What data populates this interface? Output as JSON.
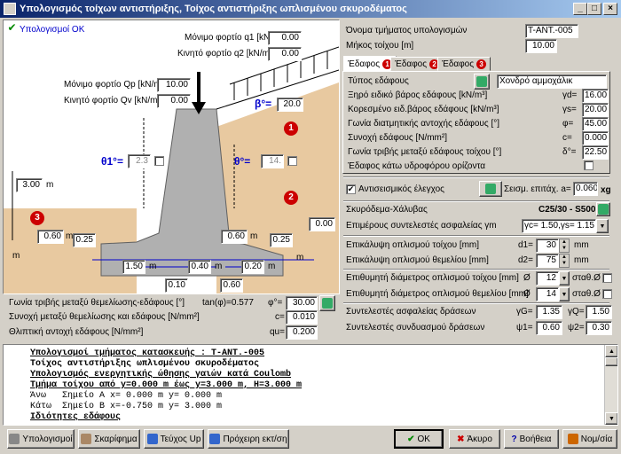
{
  "window": {
    "title": "Υπολογισμός τοίχων αντιστήριξης, Τοίχος αντιστήριξης ωπλισμένου σκυροδέματος"
  },
  "status_ok": "Υπολογισμοί ΟΚ",
  "loads": {
    "q1_label": "Μόνιμο φορτίο q1 [kN/m²]",
    "q1": "0.00",
    "q2_label": "Κινητό φορτίο q2 [kN/m²]",
    "q2": "0.00",
    "qp_label": "Μόνιμο φορτίο Qp [kN/m]",
    "qp": "10.00",
    "qv_label": "Κινητό φορτίο Qv [kN/m]",
    "qv": "0.00"
  },
  "drawing": {
    "beta_label": "β°=",
    "beta": "20.0",
    "theta1_label": "θ1°=",
    "theta1": "2.3",
    "theta_label": "θ°=",
    "theta": "14.",
    "height": "3.00",
    "m1": "m",
    "m2": "m",
    "m3": "m",
    "m4": "m",
    "m5": "m",
    "d_left": "0.60",
    "d_left2": "0.25",
    "d_right": "0.60",
    "d_right2": "0.25",
    "right_height": "0.00",
    "dim_150": "1.50",
    "dim_040": "0.40",
    "dim_020": "0.20",
    "dim_010": "0.10",
    "dim_060": "0.60",
    "m_a": "m",
    "m_b": "m",
    "m_c": "m",
    "marker1": "1",
    "marker2": "2",
    "marker3": "3"
  },
  "foundation": {
    "friction_label": "Γωνία τριβής μεταξύ θεμελίωσης-εδάφους [°]",
    "tan_label": "tan(φ)=0.577",
    "phi_label": "φ°=",
    "phi": "30.00",
    "cohesion_label": "Συνοχή μεταξύ θεμελίωσης και εδάφους [N/mm²]",
    "c_label": "c=",
    "c": "0.010",
    "bearing_label": "Θλιπτική αντοχή εδάφους [N/mm²]",
    "qu_label": "qu=",
    "qu": "0.200"
  },
  "right": {
    "name_label": "Όνομα τμήματος υπολογισμών",
    "name": "T-ANT.-005",
    "length_label": "Μήκος τοίχου [m]",
    "length": "10.00"
  },
  "tabs": [
    {
      "label": "Έδαφος",
      "badge": "1"
    },
    {
      "label": "Έδαφος",
      "badge": "2"
    },
    {
      "label": "Έδαφος",
      "badge": "3"
    }
  ],
  "soil": {
    "type_label": "Τύπος εδάφους",
    "type": "Χονδρό αμμοχάλικ",
    "dry_label": "Ξηρό ειδικό βάρος εδάφους [kN/m³]",
    "gd_label": "γd=",
    "gd": "16.00",
    "sat_label": "Κορεσμένο ειδ.βάρος εδάφους [kN/m³]",
    "gs_label": "γs=",
    "gs": "20.00",
    "angle_label": "Γωνία διατμητικής αντοχής εδάφους [°]",
    "phi_label": "φ=",
    "phi": "45.00",
    "coh_label": "Συνοχή εδάφους [N/mm²]",
    "c_label": "c=",
    "c": "0.000",
    "wall_friction_label": "Γωνία τριβής μεταξύ εδάφους τοίχου [°]",
    "delta_label": "δ°=",
    "delta": "22.50",
    "water_label": "Έδαφος κάτω υδροφόρου ορίζοντα"
  },
  "seismic": {
    "check_label": "Αντισεισμικός έλεγχος",
    "accel_label": "Σεισμ. επιτάχ. a=",
    "accel": "0.060",
    "unit": "xg"
  },
  "concrete": {
    "label": "Σκυρόδεμα-Χάλυβας",
    "value": "C25/30 - S500",
    "factors_label": "Επιμέρους συντελεστές ασφαλείας γm",
    "factors": "γc= 1.50,γs= 1.15"
  },
  "reinf": {
    "cover_wall_label": "Επικάλυψη οπλισμού τοίχου [mm]",
    "d1_label": "d1=",
    "d1": "30",
    "d1_unit": "mm",
    "cover_found_label": "Επικάλυψη οπλισμού θεμελίου [mm]",
    "d2_label": "d2=",
    "d2": "75",
    "d2_unit": "mm",
    "dia_wall_label": "Επιθυμητή διάμετρος οπλισμού τοίχου [mm]",
    "dia_wall": "12",
    "stat1": "σταθ.Ø",
    "dia_found_label": "Επιθυμητή διάμετρος οπλισμού θεμελίου [mm]",
    "dia_found": "14",
    "stat2": "σταθ.Ø",
    "phi_sym1": "Ø",
    "phi_sym2": "Ø"
  },
  "factors": {
    "safety_label": "Συντελεστές ασφαλείας δράσεων",
    "gG_label": "γG=",
    "gG": "1.35",
    "gQ_label": "γQ=",
    "gQ": "1.50",
    "comb_label": "Συντελεστές συνδυασμού δράσεων",
    "psi1_label": "ψ1=",
    "psi1": "0.60",
    "psi2_label": "ψ2=",
    "psi2": "0.30"
  },
  "output": [
    "Υπολογισμοί τμήματος κατασκευής : T-ANT.-005",
    "Τοίχος αντιστήριξης ωπλισμένου σκυροδέματος",
    "Υπολογισμός ενεργητικής ώθησης γαιών κατά Coulomb",
    "Τμήμα τοίχου από y=0.000 m έως y=3.000 m, H=3.000 m",
    "Άνω   Σημείο A x= 0.000 m y= 0.000 m",
    "Κάτω  Σημείο B x=-0.750 m y= 3.000 m",
    "Ιδιότητες εδάφους"
  ],
  "buttons": {
    "calc": "Υπολογισμοί",
    "sketch": "Σκαρίφημα",
    "report": "Τεύχος Up",
    "preview": "Πρόχειρη εκτ/ση",
    "ok": "OK",
    "cancel": "Άκυρο",
    "help": "Βοήθεια",
    "units": "Νομ/σία"
  }
}
